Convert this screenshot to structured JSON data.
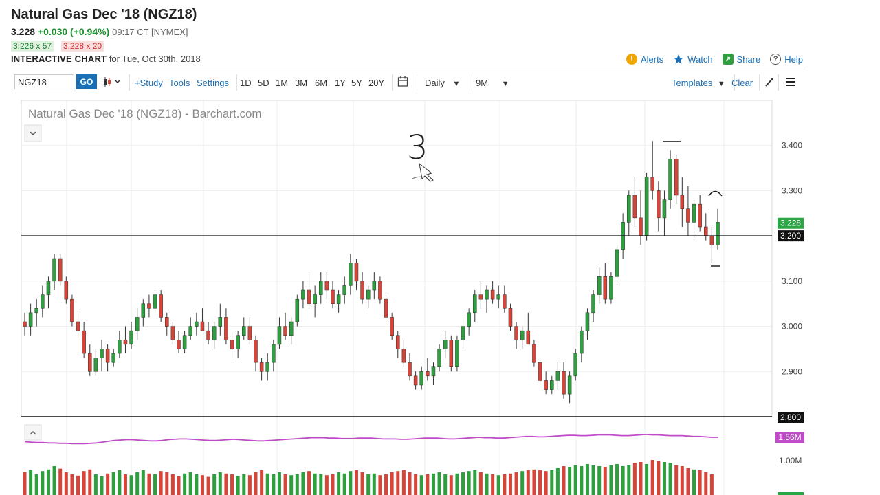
{
  "header": {
    "title": "Natural Gas Dec '18 (NGZ18)",
    "last_price": "3.228",
    "change": "+0.030 (+0.94%)",
    "time_exchange": "09:17 CT [NYMEX]",
    "bid": "3.226 x 57",
    "ask": "3.228 x 20",
    "interactive_label": "INTERACTIVE CHART",
    "date_text": "for Tue, Oct 30th, 2018"
  },
  "links": {
    "alerts": "Alerts",
    "watch": "Watch",
    "share": "Share",
    "help": "Help"
  },
  "toolbar": {
    "symbol_value": "NGZ18",
    "go": "GO",
    "study": "+Study",
    "tools": "Tools",
    "settings": "Settings",
    "periods": [
      "1D",
      "5D",
      "1M",
      "3M",
      "6M",
      "1Y",
      "5Y",
      "20Y"
    ],
    "interval": "Daily",
    "range": "9M",
    "templates": "Templates",
    "clear": "Clear"
  },
  "colors": {
    "up": "#2e9e3e",
    "down": "#d5453a",
    "link": "#1a6fb5",
    "volume_ma": "#c04bc9",
    "accent_price": "#28a745"
  },
  "chart_data": {
    "type": "candlestick",
    "title": "Natural Gas Dec '18 (NGZ18) - Barchart.com",
    "y_ticks": [
      "3.400",
      "3.300",
      "3.100",
      "3.000",
      "2.900"
    ],
    "ylim": [
      2.8,
      3.5
    ],
    "last_price_label": "3.228",
    "line_level_label": "3.200",
    "bottom_level_label": "2.800",
    "volume_ma_label": "1.56M",
    "volume_tick": "1.00M",
    "annotations": [
      "3"
    ],
    "horizontal_line": 3.2,
    "candles": [
      [
        3.01,
        3.03,
        2.98,
        3.0
      ],
      [
        3.0,
        3.05,
        2.98,
        3.03
      ],
      [
        3.03,
        3.06,
        3.0,
        3.04
      ],
      [
        3.04,
        3.09,
        3.02,
        3.07
      ],
      [
        3.07,
        3.11,
        3.04,
        3.1
      ],
      [
        3.1,
        3.16,
        3.08,
        3.15
      ],
      [
        3.15,
        3.16,
        3.09,
        3.1
      ],
      [
        3.1,
        3.11,
        3.05,
        3.06
      ],
      [
        3.06,
        3.07,
        3.0,
        3.01
      ],
      [
        3.01,
        3.03,
        2.97,
        2.99
      ],
      [
        2.99,
        3.01,
        2.93,
        2.94
      ],
      [
        2.94,
        2.96,
        2.89,
        2.9
      ],
      [
        2.9,
        2.95,
        2.89,
        2.93
      ],
      [
        2.93,
        2.97,
        2.9,
        2.95
      ],
      [
        2.95,
        2.96,
        2.9,
        2.92
      ],
      [
        2.92,
        2.95,
        2.91,
        2.94
      ],
      [
        2.94,
        2.99,
        2.93,
        2.97
      ],
      [
        2.97,
        3.0,
        2.94,
        2.96
      ],
      [
        2.96,
        3.01,
        2.95,
        2.99
      ],
      [
        2.99,
        3.04,
        2.97,
        3.02
      ],
      [
        3.02,
        3.06,
        3.0,
        3.05
      ],
      [
        3.05,
        3.07,
        3.02,
        3.04
      ],
      [
        3.04,
        3.08,
        3.03,
        3.07
      ],
      [
        3.07,
        3.08,
        3.01,
        3.02
      ],
      [
        3.02,
        3.03,
        2.98,
        3.0
      ],
      [
        3.0,
        3.01,
        2.96,
        2.97
      ],
      [
        2.97,
        2.99,
        2.94,
        2.95
      ],
      [
        2.95,
        2.99,
        2.94,
        2.98
      ],
      [
        2.98,
        3.02,
        2.97,
        3.0
      ],
      [
        3.0,
        3.03,
        2.98,
        3.01
      ],
      [
        3.01,
        3.04,
        2.99,
        2.99
      ],
      [
        2.99,
        3.01,
        2.96,
        2.97
      ],
      [
        2.97,
        3.01,
        2.95,
        3.0
      ],
      [
        3.0,
        3.05,
        2.98,
        3.02
      ],
      [
        3.02,
        3.04,
        2.96,
        2.97
      ],
      [
        2.97,
        2.99,
        2.93,
        2.95
      ],
      [
        2.95,
        2.99,
        2.93,
        2.98
      ],
      [
        2.98,
        3.02,
        2.97,
        3.0
      ],
      [
        3.0,
        3.02,
        2.96,
        2.97
      ],
      [
        2.97,
        2.98,
        2.9,
        2.92
      ],
      [
        2.92,
        2.93,
        2.88,
        2.9
      ],
      [
        2.9,
        2.94,
        2.88,
        2.92
      ],
      [
        2.92,
        2.97,
        2.9,
        2.96
      ],
      [
        2.96,
        3.02,
        2.95,
        3.0
      ],
      [
        3.0,
        3.03,
        2.97,
        2.98
      ],
      [
        2.98,
        3.02,
        2.96,
        3.01
      ],
      [
        3.01,
        3.07,
        3.0,
        3.06
      ],
      [
        3.06,
        3.1,
        3.04,
        3.08
      ],
      [
        3.08,
        3.12,
        3.04,
        3.05
      ],
      [
        3.05,
        3.09,
        3.02,
        3.07
      ],
      [
        3.07,
        3.12,
        3.05,
        3.1
      ],
      [
        3.1,
        3.12,
        3.06,
        3.08
      ],
      [
        3.08,
        3.1,
        3.04,
        3.05
      ],
      [
        3.05,
        3.08,
        3.03,
        3.07
      ],
      [
        3.07,
        3.11,
        3.05,
        3.09
      ],
      [
        3.09,
        3.16,
        3.07,
        3.14
      ],
      [
        3.14,
        3.15,
        3.08,
        3.1
      ],
      [
        3.1,
        3.12,
        3.05,
        3.06
      ],
      [
        3.06,
        3.09,
        3.04,
        3.08
      ],
      [
        3.08,
        3.12,
        3.06,
        3.1
      ],
      [
        3.1,
        3.11,
        3.05,
        3.06
      ],
      [
        3.06,
        3.07,
        3.01,
        3.02
      ],
      [
        3.02,
        3.03,
        2.97,
        2.98
      ],
      [
        2.98,
        2.99,
        2.93,
        2.95
      ],
      [
        2.95,
        2.97,
        2.91,
        2.92
      ],
      [
        2.92,
        2.94,
        2.88,
        2.89
      ],
      [
        2.89,
        2.9,
        2.86,
        2.87
      ],
      [
        2.87,
        2.91,
        2.86,
        2.9
      ],
      [
        2.9,
        2.93,
        2.88,
        2.89
      ],
      [
        2.89,
        2.92,
        2.87,
        2.91
      ],
      [
        2.91,
        2.96,
        2.9,
        2.95
      ],
      [
        2.95,
        2.99,
        2.93,
        2.97
      ],
      [
        2.97,
        2.98,
        2.9,
        2.91
      ],
      [
        2.91,
        2.98,
        2.9,
        2.97
      ],
      [
        2.97,
        3.02,
        2.95,
        3.0
      ],
      [
        3.0,
        3.04,
        2.98,
        3.03
      ],
      [
        3.03,
        3.08,
        3.01,
        3.07
      ],
      [
        3.07,
        3.1,
        3.04,
        3.06
      ],
      [
        3.06,
        3.09,
        3.03,
        3.08
      ],
      [
        3.08,
        3.1,
        3.05,
        3.06
      ],
      [
        3.06,
        3.09,
        3.04,
        3.07
      ],
      [
        3.07,
        3.09,
        3.03,
        3.04
      ],
      [
        3.04,
        3.05,
        2.99,
        3.0
      ],
      [
        3.0,
        3.01,
        2.95,
        2.97
      ],
      [
        2.97,
        3.0,
        2.95,
        2.99
      ],
      [
        2.99,
        3.03,
        2.96,
        2.96
      ],
      [
        2.96,
        2.97,
        2.91,
        2.92
      ],
      [
        2.92,
        2.93,
        2.87,
        2.88
      ],
      [
        2.88,
        2.9,
        2.85,
        2.86
      ],
      [
        2.86,
        2.89,
        2.85,
        2.88
      ],
      [
        2.88,
        2.92,
        2.86,
        2.9
      ],
      [
        2.9,
        2.92,
        2.84,
        2.85
      ],
      [
        2.85,
        2.9,
        2.83,
        2.89
      ],
      [
        2.89,
        2.95,
        2.88,
        2.94
      ],
      [
        2.94,
        3.0,
        2.92,
        2.99
      ],
      [
        2.99,
        3.04,
        2.97,
        3.03
      ],
      [
        3.03,
        3.08,
        3.01,
        3.07
      ],
      [
        3.07,
        3.13,
        3.05,
        3.11
      ],
      [
        3.11,
        3.14,
        3.05,
        3.06
      ],
      [
        3.06,
        3.12,
        3.05,
        3.11
      ],
      [
        3.11,
        3.18,
        3.09,
        3.17
      ],
      [
        3.17,
        3.25,
        3.15,
        3.23
      ],
      [
        3.23,
        3.3,
        3.2,
        3.29
      ],
      [
        3.29,
        3.33,
        3.22,
        3.24
      ],
      [
        3.24,
        3.3,
        3.18,
        3.2
      ],
      [
        3.2,
        3.34,
        3.19,
        3.33
      ],
      [
        3.33,
        3.41,
        3.28,
        3.3
      ],
      [
        3.3,
        3.32,
        3.21,
        3.24
      ],
      [
        3.24,
        3.3,
        3.2,
        3.28
      ],
      [
        3.28,
        3.39,
        3.26,
        3.37
      ],
      [
        3.37,
        3.38,
        3.27,
        3.29
      ],
      [
        3.29,
        3.33,
        3.22,
        3.26
      ],
      [
        3.26,
        3.31,
        3.2,
        3.23
      ],
      [
        3.23,
        3.28,
        3.19,
        3.27
      ],
      [
        3.27,
        3.29,
        3.21,
        3.22
      ],
      [
        3.22,
        3.25,
        3.19,
        3.2
      ],
      [
        3.2,
        3.22,
        3.14,
        3.18
      ],
      [
        3.18,
        3.26,
        3.17,
        3.23
      ]
    ],
    "volume": [
      0.55,
      0.6,
      0.5,
      0.58,
      0.62,
      0.7,
      0.64,
      0.55,
      0.5,
      0.47,
      0.58,
      0.62,
      0.5,
      0.45,
      0.52,
      0.55,
      0.6,
      0.5,
      0.48,
      0.55,
      0.6,
      0.52,
      0.5,
      0.58,
      0.55,
      0.5,
      0.45,
      0.52,
      0.55,
      0.5,
      0.48,
      0.44,
      0.5,
      0.55,
      0.52,
      0.5,
      0.46,
      0.5,
      0.48,
      0.55,
      0.6,
      0.52,
      0.5,
      0.55,
      0.5,
      0.48,
      0.5,
      0.55,
      0.58,
      0.52,
      0.5,
      0.48,
      0.5,
      0.55,
      0.52,
      0.58,
      0.6,
      0.55,
      0.5,
      0.52,
      0.48,
      0.5,
      0.55,
      0.58,
      0.6,
      0.55,
      0.5,
      0.48,
      0.5,
      0.52,
      0.55,
      0.5,
      0.48,
      0.52,
      0.55,
      0.58,
      0.6,
      0.55,
      0.52,
      0.5,
      0.48,
      0.5,
      0.52,
      0.55,
      0.58,
      0.6,
      0.62,
      0.6,
      0.58,
      0.6,
      0.65,
      0.7,
      0.68,
      0.72,
      0.7,
      0.75,
      0.72,
      0.7,
      0.68,
      0.72,
      0.75,
      0.7,
      0.72,
      0.78,
      0.8,
      0.75,
      0.85,
      0.82,
      0.8,
      0.78,
      0.72,
      0.7,
      0.65,
      0.62,
      0.6,
      0.55,
      0.5
    ],
    "volume_ma": [
      1.45,
      1.44,
      1.43,
      1.43,
      1.42,
      1.42,
      1.41,
      1.41,
      1.4,
      1.4,
      1.4,
      1.41,
      1.42,
      1.44,
      1.46,
      1.48,
      1.49,
      1.5,
      1.5,
      1.49,
      1.48,
      1.47,
      1.47,
      1.48,
      1.5,
      1.51,
      1.52,
      1.52,
      1.51,
      1.5,
      1.49,
      1.48,
      1.48,
      1.49,
      1.5,
      1.51,
      1.5,
      1.49,
      1.48,
      1.47,
      1.47,
      1.48,
      1.49,
      1.5,
      1.51,
      1.52,
      1.53,
      1.54,
      1.55,
      1.55,
      1.55,
      1.54,
      1.54,
      1.53,
      1.53,
      1.53,
      1.54,
      1.54,
      1.54,
      1.53,
      1.52,
      1.52,
      1.52,
      1.51,
      1.51,
      1.52,
      1.53,
      1.54,
      1.54,
      1.54,
      1.53,
      1.52,
      1.52,
      1.53,
      1.54,
      1.55,
      1.56,
      1.55,
      1.55,
      1.54,
      1.54,
      1.55,
      1.56,
      1.57,
      1.58,
      1.58,
      1.57,
      1.57,
      1.58,
      1.59,
      1.6,
      1.61,
      1.61,
      1.6,
      1.6,
      1.61,
      1.62,
      1.62,
      1.62,
      1.61,
      1.6,
      1.6,
      1.61,
      1.62,
      1.63,
      1.62,
      1.62,
      1.61,
      1.6,
      1.6,
      1.6,
      1.59,
      1.58,
      1.58,
      1.57,
      1.56,
      1.56
    ]
  }
}
